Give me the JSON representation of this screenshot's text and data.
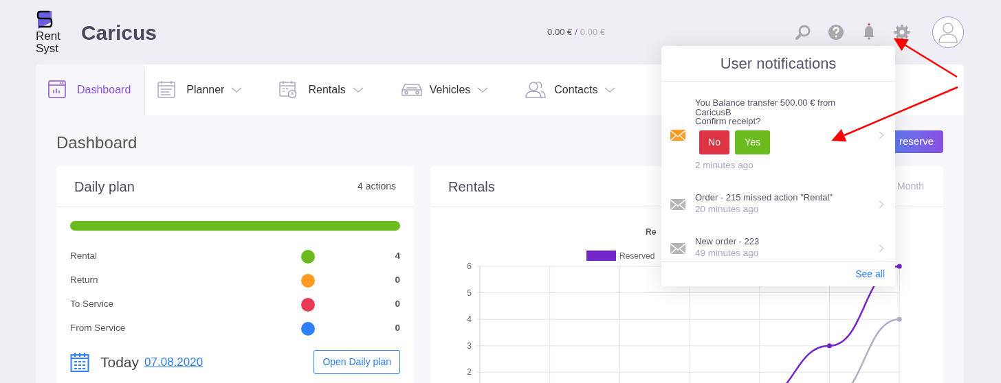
{
  "brand": {
    "logo_line1": "Rent",
    "logo_line2": "Syst",
    "company": "Caricus"
  },
  "balance": {
    "amount": "0.00 €",
    "separator": "/",
    "secondary": "0.00 €"
  },
  "header": {
    "notifications_unread": true
  },
  "tabs": [
    {
      "label": "Dashboard",
      "selected": true,
      "has_dropdown": false
    },
    {
      "label": "Planner",
      "selected": false,
      "has_dropdown": true
    },
    {
      "label": "Rentals",
      "selected": false,
      "has_dropdown": true
    },
    {
      "label": "Vehicles",
      "selected": false,
      "has_dropdown": true
    },
    {
      "label": "Contacts",
      "selected": false,
      "has_dropdown": true
    }
  ],
  "page_title": "Dashboard",
  "add_button": "reserve",
  "daily_plan": {
    "title": "Daily plan",
    "count": "4 actions",
    "level": 1,
    "rows": [
      {
        "label": "Rental",
        "color": "#6cbb1e",
        "value": "4"
      },
      {
        "label": "Return",
        "color": "#fd9a22",
        "value": "0"
      },
      {
        "label": "To Service",
        "color": "#e83b56",
        "value": "0"
      },
      {
        "label": "From Service",
        "color": "#2f80f8",
        "value": "0"
      }
    ],
    "today_label": "Today",
    "today_date": "07.08.2020",
    "open_button": "Open Daily plan"
  },
  "rentals": {
    "title": "Rentals",
    "period": "Month",
    "chart": {
      "title": "Re",
      "legend": "Reserved",
      "y_labels": [
        "6",
        "5",
        "4",
        "3",
        "2"
      ]
    }
  },
  "notifications": {
    "title": "User notifications",
    "see_all": "See all",
    "items": [
      {
        "kind": "confirm",
        "unread": true,
        "lines": [
          "You Balance transfer 500.00 € from",
          "CaricusB",
          "Confirm receipt?"
        ],
        "no": "No",
        "yes": "Yes",
        "time": "2 minutes ago"
      },
      {
        "kind": "plain",
        "unread": false,
        "lines": [
          "Order - 215 missed action \"Rental\""
        ],
        "time": "20 minutes ago"
      },
      {
        "kind": "plain",
        "unread": false,
        "lines": [
          "New order - 223"
        ],
        "time": "49 minutes ago"
      }
    ]
  }
}
